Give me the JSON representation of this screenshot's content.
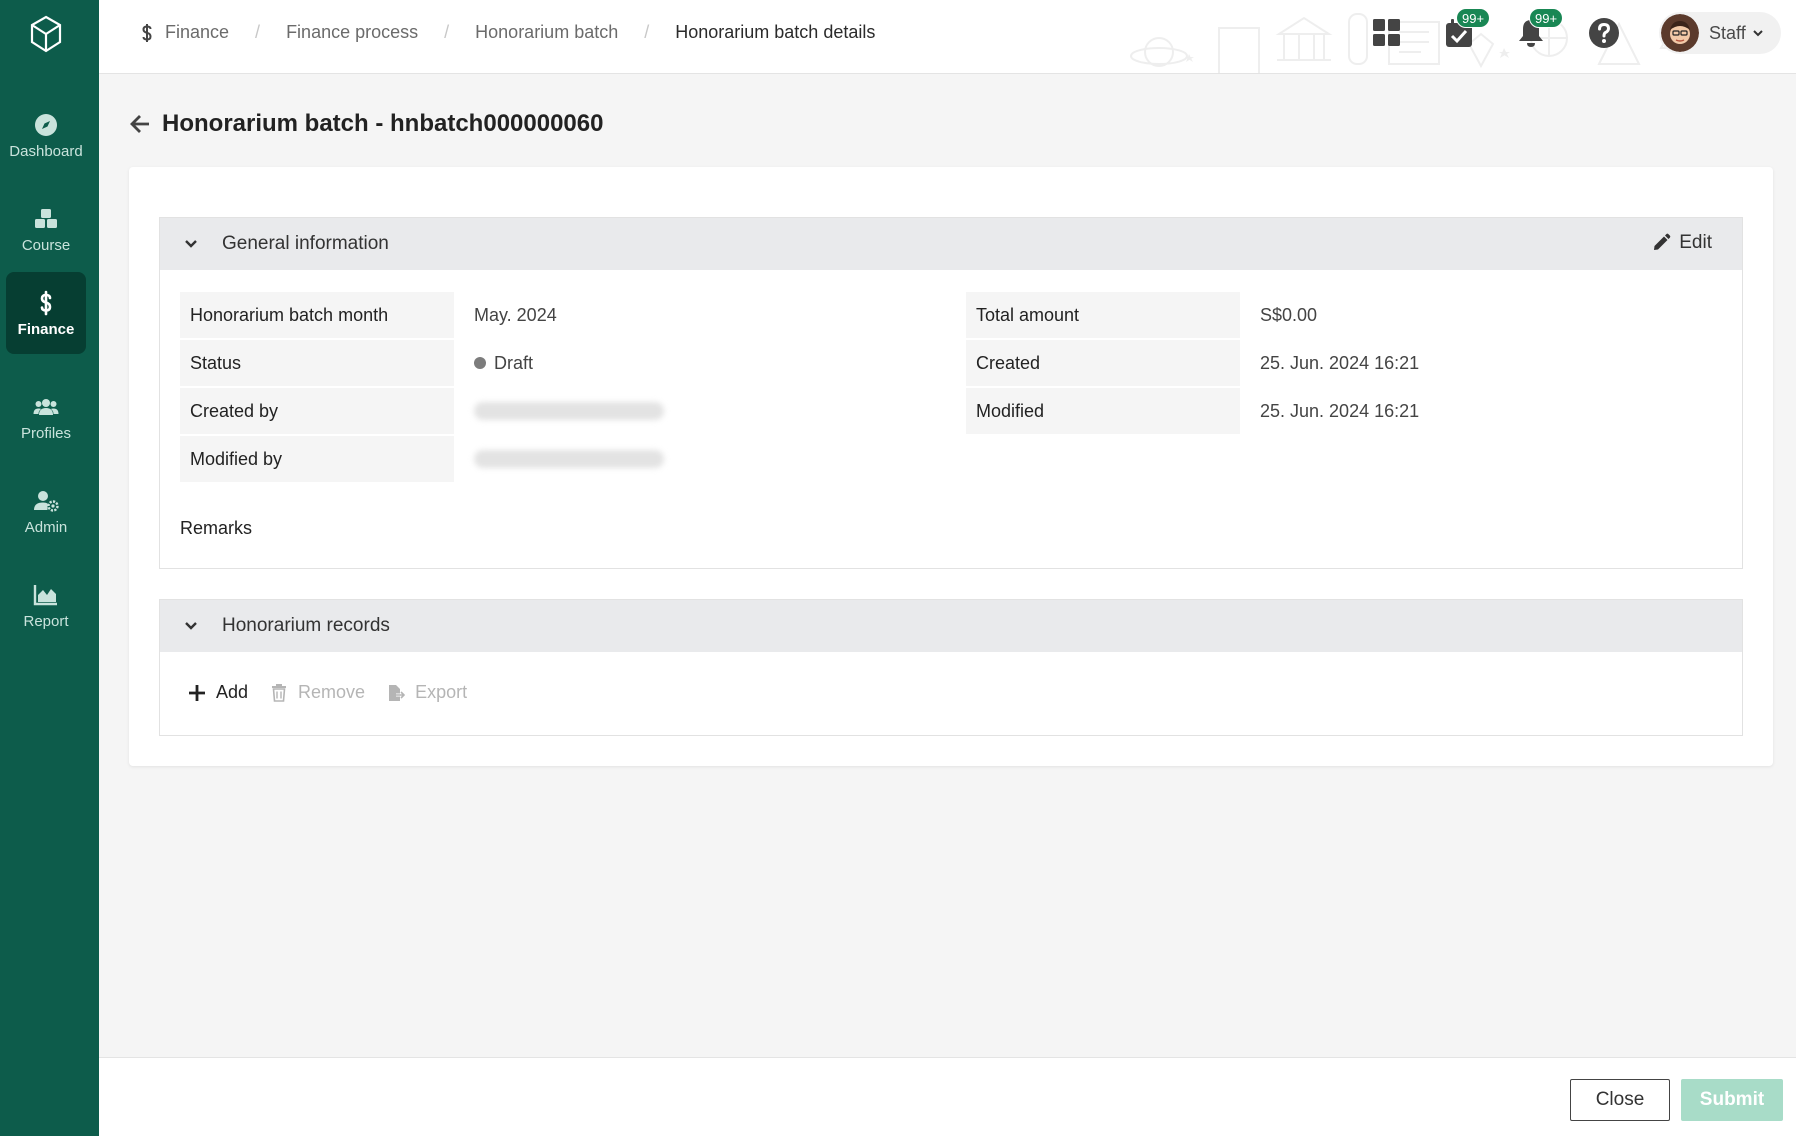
{
  "sidebar": {
    "items": [
      {
        "label": "Dashboard",
        "icon": "compass-icon"
      },
      {
        "label": "Course",
        "icon": "cubes-icon"
      },
      {
        "label": "Finance",
        "icon": "dollar-icon",
        "active": true
      },
      {
        "label": "Profiles",
        "icon": "users-icon"
      },
      {
        "label": "Admin",
        "icon": "user-gear-icon"
      },
      {
        "label": "Report",
        "icon": "area-chart-icon"
      }
    ]
  },
  "breadcrumb": [
    "Finance",
    "Finance process",
    "Honorarium batch",
    "Honorarium batch details"
  ],
  "header": {
    "tasks_badge": "99+",
    "notifications_badge": "99+",
    "user_name": "Staff"
  },
  "page": {
    "title": "Honorarium batch - hnbatch000000060"
  },
  "general": {
    "title": "General information",
    "edit_label": "Edit",
    "fields_left": [
      {
        "label": "Honorarium batch month",
        "value": "May. 2024"
      },
      {
        "label": "Status",
        "value": "Draft"
      },
      {
        "label": "Created by",
        "value": ""
      },
      {
        "label": "Modified by",
        "value": ""
      }
    ],
    "fields_right": [
      {
        "label": "Total amount",
        "value": "S$0.00"
      },
      {
        "label": "Created",
        "value": "25. Jun. 2024 16:21"
      },
      {
        "label": "Modified",
        "value": "25. Jun. 2024 16:21"
      }
    ],
    "remarks_label": "Remarks"
  },
  "records": {
    "title": "Honorarium records",
    "add_label": "Add",
    "remove_label": "Remove",
    "export_label": "Export"
  },
  "footer": {
    "close_label": "Close",
    "submit_label": "Submit"
  },
  "colors": {
    "sidebar": "#0d5c4b",
    "sidebar_active": "#063e32",
    "badge": "#198754",
    "submit_disabled": "#a8dcc8"
  }
}
